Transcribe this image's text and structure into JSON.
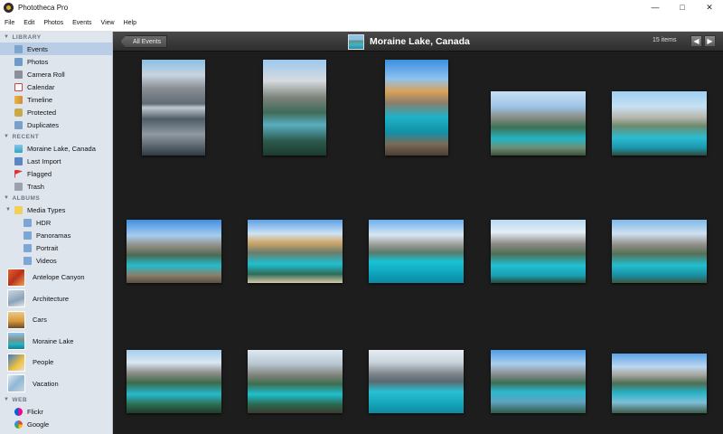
{
  "window": {
    "title": "Phototheca Pro"
  },
  "menu": [
    "File",
    "Edit",
    "Photos",
    "Events",
    "View",
    "Help"
  ],
  "sidebar": {
    "library_header": "LIBRARY",
    "library": [
      {
        "label": "Events",
        "icon": "events-icon",
        "selected": true
      },
      {
        "label": "Photos",
        "icon": "photos-icon"
      },
      {
        "label": "Camera Roll",
        "icon": "camera-roll-icon"
      },
      {
        "label": "Calendar",
        "icon": "calendar-icon"
      },
      {
        "label": "Timeline",
        "icon": "timeline-icon"
      },
      {
        "label": "Protected",
        "icon": "protected-icon"
      },
      {
        "label": "Duplicates",
        "icon": "duplicates-icon"
      }
    ],
    "recent_header": "RECENT",
    "recent": [
      {
        "label": "Moraine Lake, Canada",
        "icon": "event-icon"
      },
      {
        "label": "Last Import",
        "icon": "import-icon"
      },
      {
        "label": "Flagged",
        "icon": "flag-icon"
      },
      {
        "label": "Trash",
        "icon": "trash-icon"
      }
    ],
    "albums_header": "ALBUMS",
    "media_types": "Media Types",
    "media_items": [
      "HDR",
      "Panoramas",
      "Portrait",
      "Videos"
    ],
    "albums": [
      {
        "label": "Antelope Canyon",
        "icon": "antelope-canyon-thumb"
      },
      {
        "label": "Architecture",
        "icon": "architecture-thumb"
      },
      {
        "label": "Cars",
        "icon": "cars-thumb"
      },
      {
        "label": "Moraine Lake",
        "icon": "moraine-lake-thumb"
      },
      {
        "label": "People",
        "icon": "people-thumb"
      },
      {
        "label": "Vacation",
        "icon": "vacation-thumb"
      }
    ],
    "web_header": "WEB",
    "web": [
      {
        "label": "Flickr",
        "icon": "flickr-icon"
      },
      {
        "label": "Google",
        "icon": "google-icon"
      }
    ]
  },
  "toolbar": {
    "back_label": "All Events",
    "event_title": "Moraine Lake, Canada",
    "items_count": "15 items"
  },
  "colors": {
    "sidebar_bg": "#dfe5ed",
    "selection": "#b9cde6",
    "main_bg": "#1d1d1d",
    "lake_turquoise": "#23b5c9",
    "sky_blue": "#7fb7e6"
  }
}
